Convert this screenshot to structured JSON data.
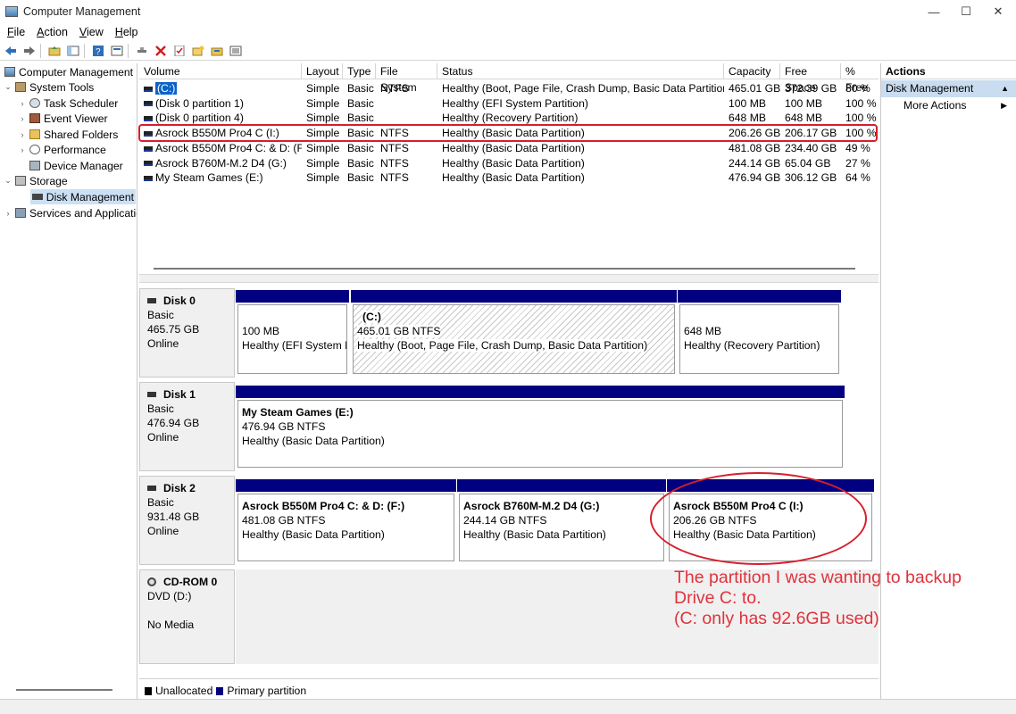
{
  "window": {
    "title": "Computer Management",
    "controls": [
      "—",
      "☐",
      "✕"
    ]
  },
  "menu": [
    {
      "label": "File"
    },
    {
      "label": "Action"
    },
    {
      "label": "View"
    },
    {
      "label": "Help"
    }
  ],
  "toolbar": {
    "icons": [
      "back-icon",
      "forward-icon",
      "up-folder-icon",
      "show-hide-tree-icon",
      "help-icon",
      "properties-icon",
      "connect-icon",
      "delete-icon",
      "check-icon",
      "new-folder-icon",
      "open-folder-icon",
      "list-icon"
    ]
  },
  "tree": [
    {
      "label": "Computer Management",
      "level": 0,
      "expander": ""
    },
    {
      "label": "System Tools",
      "level": 1,
      "expander": "⌄"
    },
    {
      "label": "Task Scheduler",
      "level": 2,
      "expander": "›"
    },
    {
      "label": "Event Viewer",
      "level": 2,
      "expander": "›"
    },
    {
      "label": "Shared Folders",
      "level": 2,
      "expander": "›"
    },
    {
      "label": "Performance",
      "level": 2,
      "expander": "›"
    },
    {
      "label": "Device Manager",
      "level": 2,
      "expander": ""
    },
    {
      "label": "Storage",
      "level": 1,
      "expander": "⌄"
    },
    {
      "label": "Disk Management",
      "level": 2,
      "expander": "",
      "selected": true
    },
    {
      "label": "Services and Applications",
      "level": 1,
      "expander": "›"
    }
  ],
  "volumes": {
    "columns": [
      "Volume",
      "Layout",
      "Type",
      "File System",
      "Status",
      "Capacity",
      "Free Space",
      "% Free"
    ],
    "rows": [
      [
        "(C:)",
        "Simple",
        "Basic",
        "NTFS",
        "Healthy (Boot, Page File, Crash Dump, Basic Data Partition)",
        "465.01 GB",
        "372.39 GB",
        "80 %"
      ],
      [
        "(Disk 0 partition 1)",
        "Simple",
        "Basic",
        "",
        "Healthy (EFI System Partition)",
        "100 MB",
        "100 MB",
        "100 %"
      ],
      [
        "(Disk 0 partition 4)",
        "Simple",
        "Basic",
        "",
        "Healthy (Recovery Partition)",
        "648 MB",
        "648 MB",
        "100 %"
      ],
      [
        "Asrock B550M Pro4 C (I:)",
        "Simple",
        "Basic",
        "NTFS",
        "Healthy (Basic Data Partition)",
        "206.26 GB",
        "206.17 GB",
        "100 %"
      ],
      [
        "Asrock B550M Pro4 C: & D: (F:)",
        "Simple",
        "Basic",
        "NTFS",
        "Healthy (Basic Data Partition)",
        "481.08 GB",
        "234.40 GB",
        "49 %"
      ],
      [
        "Asrock B760M-M.2 D4 (G:)",
        "Simple",
        "Basic",
        "NTFS",
        "Healthy (Basic Data Partition)",
        "244.14 GB",
        "65.04 GB",
        "27 %"
      ],
      [
        "My Steam Games (E:)",
        "Simple",
        "Basic",
        "NTFS",
        "Healthy (Basic Data Partition)",
        "476.94 GB",
        "306.12 GB",
        "64 %"
      ]
    ]
  },
  "disks": [
    {
      "name": "Disk 0",
      "type": "Basic",
      "size": "465.75 GB",
      "state": "Online",
      "partitions": [
        {
          "name": "",
          "size": "100 MB",
          "status": "Healthy (EFI System Partition)"
        },
        {
          "name": "(C:)",
          "size": "465.01 GB NTFS",
          "status": "Healthy (Boot, Page File, Crash Dump, Basic Data Partition)"
        },
        {
          "name": "",
          "size": "648 MB",
          "status": "Healthy (Recovery Partition)"
        }
      ]
    },
    {
      "name": "Disk 1",
      "type": "Basic",
      "size": "476.94 GB",
      "state": "Online",
      "partitions": [
        {
          "name": "My Steam Games  (E:)",
          "size": "476.94 GB NTFS",
          "status": "Healthy (Basic Data Partition)"
        }
      ]
    },
    {
      "name": "Disk 2",
      "type": "Basic",
      "size": "931.48 GB",
      "state": "Online",
      "partitions": [
        {
          "name": "Asrock B550M Pro4 C: & D:  (F:)",
          "size": "481.08 GB NTFS",
          "status": "Healthy (Basic Data Partition)"
        },
        {
          "name": "Asrock B760M-M.2 D4  (G:)",
          "size": "244.14 GB NTFS",
          "status": "Healthy (Basic Data Partition)"
        },
        {
          "name": "Asrock B550M Pro4 C  (I:)",
          "size": "206.26 GB NTFS",
          "status": "Healthy (Basic Data Partition)"
        }
      ]
    }
  ],
  "cdrom": {
    "name": "CD-ROM 0",
    "type": "DVD (D:)",
    "state": "No Media"
  },
  "legend": [
    {
      "label": "Unallocated",
      "color": "#000000"
    },
    {
      "label": "Primary partition",
      "color": "#000080"
    }
  ],
  "actions": {
    "header": "Actions",
    "section": "Disk Management",
    "items": [
      "More Actions"
    ]
  },
  "annotation": {
    "color": "#e0323c",
    "lines": [
      "The partition I was wanting to backup",
      "Drive C: to.",
      "(C: only has 92.6GB used)"
    ]
  }
}
